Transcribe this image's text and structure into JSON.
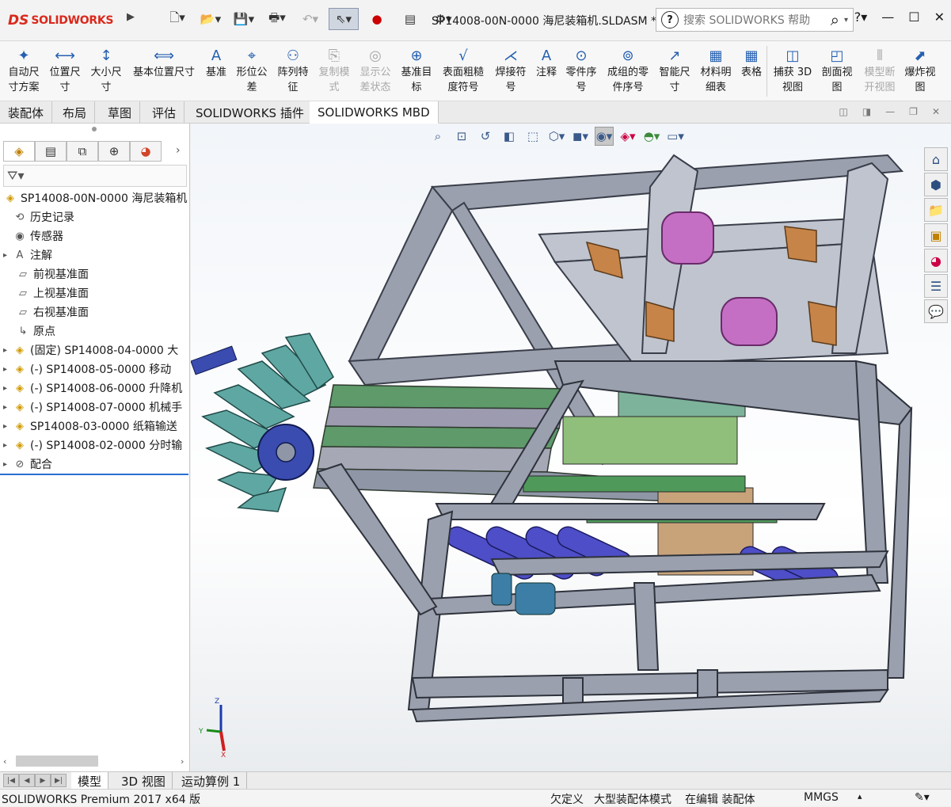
{
  "app": {
    "brand_mark": "DS",
    "brand_name": "SOLIDWORKS",
    "document_title": "SP14008-00N-0000 海尼装箱机.SLDASM *",
    "search_placeholder": "搜索 SOLIDWORKS 帮助"
  },
  "quick_access": {
    "icons": [
      "new-document-icon",
      "open-icon",
      "save-icon",
      "print-icon",
      "undo-icon",
      "select-icon",
      "traffic-light-icon",
      "file-properties-icon",
      "gear-icon"
    ]
  },
  "commands": [
    {
      "label": "自动尺\n寸方案",
      "icon": "auto-dimension-icon",
      "disabled": false
    },
    {
      "label": "位置尺\n寸",
      "icon": "location-dimension-icon",
      "disabled": false
    },
    {
      "label": "大小尺\n寸",
      "icon": "size-dimension-icon",
      "disabled": false
    },
    {
      "label": "基本位置尺寸",
      "icon": "basic-location-dimension-icon",
      "disabled": false
    },
    {
      "label": "基准",
      "icon": "datum-icon",
      "disabled": false
    },
    {
      "label": "形位公\n差",
      "icon": "geometric-tolerance-icon",
      "disabled": false
    },
    {
      "label": "阵列特\n征",
      "icon": "pattern-feature-icon",
      "disabled": false
    },
    {
      "label": "复制模\n式",
      "icon": "copy-scheme-icon",
      "disabled": true
    },
    {
      "label": "显示公\n差状态",
      "icon": "show-tolerance-status-icon",
      "disabled": true
    },
    {
      "label": "基准目\n标",
      "icon": "datum-target-icon",
      "disabled": false
    },
    {
      "label": "表面粗糙\n度符号",
      "icon": "surface-finish-icon",
      "disabled": false
    },
    {
      "label": "焊接符\n号",
      "icon": "weld-symbol-icon",
      "disabled": false
    },
    {
      "label": "注释",
      "icon": "note-icon",
      "disabled": false
    },
    {
      "label": "零件序\n号",
      "icon": "balloon-icon",
      "disabled": false
    },
    {
      "label": "成组的零\n件序号",
      "icon": "stacked-balloon-icon",
      "disabled": false
    },
    {
      "label": "智能尺\n寸",
      "icon": "smart-dimension-icon",
      "disabled": false
    },
    {
      "label": "材料明\n细表",
      "icon": "bill-of-materials-icon",
      "disabled": false
    },
    {
      "label": "表格",
      "icon": "table-icon",
      "disabled": false
    },
    {
      "label": "捕获 3D\n视图",
      "icon": "capture-3d-view-icon",
      "disabled": false
    },
    {
      "label": "剖面视\n图",
      "icon": "section-view-icon",
      "disabled": false
    },
    {
      "label": "模型断\n开视图",
      "icon": "model-break-view-icon",
      "disabled": true
    },
    {
      "label": "爆炸视\n图",
      "icon": "explode-view-icon",
      "disabled": false
    }
  ],
  "tabs": [
    "装配体",
    "布局",
    "草图",
    "评估",
    "SOLIDWORKS 插件",
    "SOLIDWORKS MBD"
  ],
  "active_tab": "SOLIDWORKS MBD",
  "feature_tree": {
    "root": "SP14008-00N-0000 海尼装箱机",
    "items": [
      {
        "label": "历史记录",
        "icon": "history-icon",
        "expandable": false
      },
      {
        "label": "传感器",
        "icon": "sensor-icon",
        "expandable": false
      },
      {
        "label": "注解",
        "icon": "annotation-icon",
        "expandable": true
      },
      {
        "label": "前视基准面",
        "icon": "plane-icon",
        "expandable": false
      },
      {
        "label": "上视基准面",
        "icon": "plane-icon",
        "expandable": false
      },
      {
        "label": "右视基准面",
        "icon": "plane-icon",
        "expandable": false
      },
      {
        "label": "原点",
        "icon": "origin-icon",
        "expandable": false
      },
      {
        "label": "(固定) SP14008-04-0000 大",
        "icon": "assembly-icon",
        "expandable": true
      },
      {
        "label": "(-) SP14008-05-0000 移动",
        "icon": "assembly-icon",
        "expandable": true
      },
      {
        "label": "(-) SP14008-06-0000 升降机",
        "icon": "assembly-icon",
        "expandable": true
      },
      {
        "label": "(-) SP14008-07-0000 机械手",
        "icon": "assembly-icon",
        "expandable": true
      },
      {
        "label": "SP14008-03-0000 纸箱输送",
        "icon": "assembly-icon",
        "expandable": true
      },
      {
        "label": "(-) SP14008-02-0000 分时输",
        "icon": "assembly-icon",
        "expandable": true
      },
      {
        "label": "配合",
        "icon": "mates-icon",
        "expandable": true
      }
    ]
  },
  "view_toolbar": {
    "icons": [
      "zoom-to-fit-icon",
      "zoom-to-area-icon",
      "previous-view-icon",
      "section-view-icon",
      "dynamic-annotation-icon",
      "view-orientation-icon",
      "display-style-icon",
      "hide-show-icon",
      "edit-appearance-icon",
      "apply-scene-icon",
      "view-settings-icon"
    ]
  },
  "task_pane": {
    "icons": [
      "home-icon",
      "3d-content-icon",
      "design-library-icon",
      "file-explorer-icon",
      "appearances-icon",
      "custom-properties-icon",
      "forum-icon"
    ]
  },
  "bottom_tabs": [
    "模型",
    "3D 视图",
    "运动算例 1"
  ],
  "active_bottom_tab": "模型",
  "status": {
    "product": "SOLIDWORKS Premium 2017 x64 版",
    "defined": "欠定义",
    "mode": "大型装配体模式",
    "editing": "在编辑 装配体",
    "units": "MMGS"
  }
}
